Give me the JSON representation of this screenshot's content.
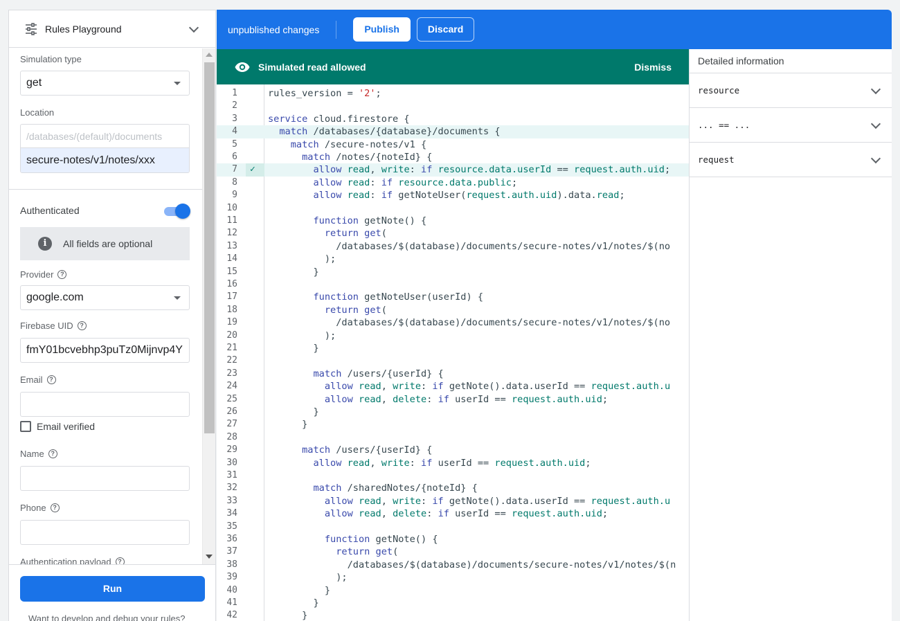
{
  "left_panel": {
    "title": "Rules Playground",
    "simulation_type": {
      "label": "Simulation type",
      "value": "get"
    },
    "location": {
      "label": "Location",
      "prefix": "/databases/(default)/documents",
      "value": "secure-notes/v1/notes/xxx"
    },
    "authenticated": {
      "label": "Authenticated",
      "on": true
    },
    "info": "All fields are optional",
    "provider": {
      "label": "Provider",
      "value": "google.com"
    },
    "firebase_uid": {
      "label": "Firebase UID",
      "value": "fmY01bcvebhp3puTz0Mijnvp4Y"
    },
    "email": {
      "label": "Email",
      "value": ""
    },
    "email_verified": {
      "label": "Email verified",
      "checked": false
    },
    "name": {
      "label": "Name",
      "value": ""
    },
    "phone": {
      "label": "Phone",
      "value": ""
    },
    "auth_payload": {
      "label": "Authentication payload"
    },
    "run_label": "Run",
    "footer_note": "Want to develop and debug your rules?"
  },
  "topbar": {
    "status": "unpublished changes",
    "publish_label": "Publish",
    "discard_label": "Discard",
    "color": "#1a73e8"
  },
  "banner": {
    "message": "Simulated read allowed",
    "dismiss_label": "Dismiss",
    "color": "#00796b"
  },
  "editor": {
    "highlight_line": 4,
    "allowed_line": 7,
    "lines": [
      "rules_version = '2';",
      "",
      "service cloud.firestore {",
      "  match /databases/{database}/documents {",
      "    match /secure-notes/v1 {",
      "      match /notes/{noteId} {",
      "        allow read, write: if resource.data.userId == request.auth.uid;",
      "        allow read: if resource.data.public;",
      "        allow read: if getNoteUser(request.auth.uid).data.read;",
      "",
      "        function getNote() {",
      "          return get(",
      "            /databases/$(database)/documents/secure-notes/v1/notes/$(no",
      "          );",
      "        }",
      "",
      "        function getNoteUser(userId) {",
      "          return get(",
      "            /databases/$(database)/documents/secure-notes/v1/notes/$(no",
      "          );",
      "        }",
      "",
      "        match /users/{userId} {",
      "          allow read, write: if getNote().data.userId == request.auth.u",
      "          allow read, delete: if userId == request.auth.uid;",
      "        }",
      "      }",
      "",
      "      match /users/{userId} {",
      "        allow read, write: if userId == request.auth.uid;",
      "",
      "        match /sharedNotes/{noteId} {",
      "          allow read, write: if getNote().data.userId == request.auth.u",
      "          allow read, delete: if userId == request.auth.uid;",
      "",
      "          function getNote() {",
      "            return get(",
      "              /databases/$(database)/documents/secure-notes/v1/notes/$(n",
      "            );",
      "          }",
      "        }",
      "      }"
    ]
  },
  "right_panel": {
    "title": "Detailed information",
    "rows": [
      "resource",
      "... == ...",
      "request"
    ]
  }
}
